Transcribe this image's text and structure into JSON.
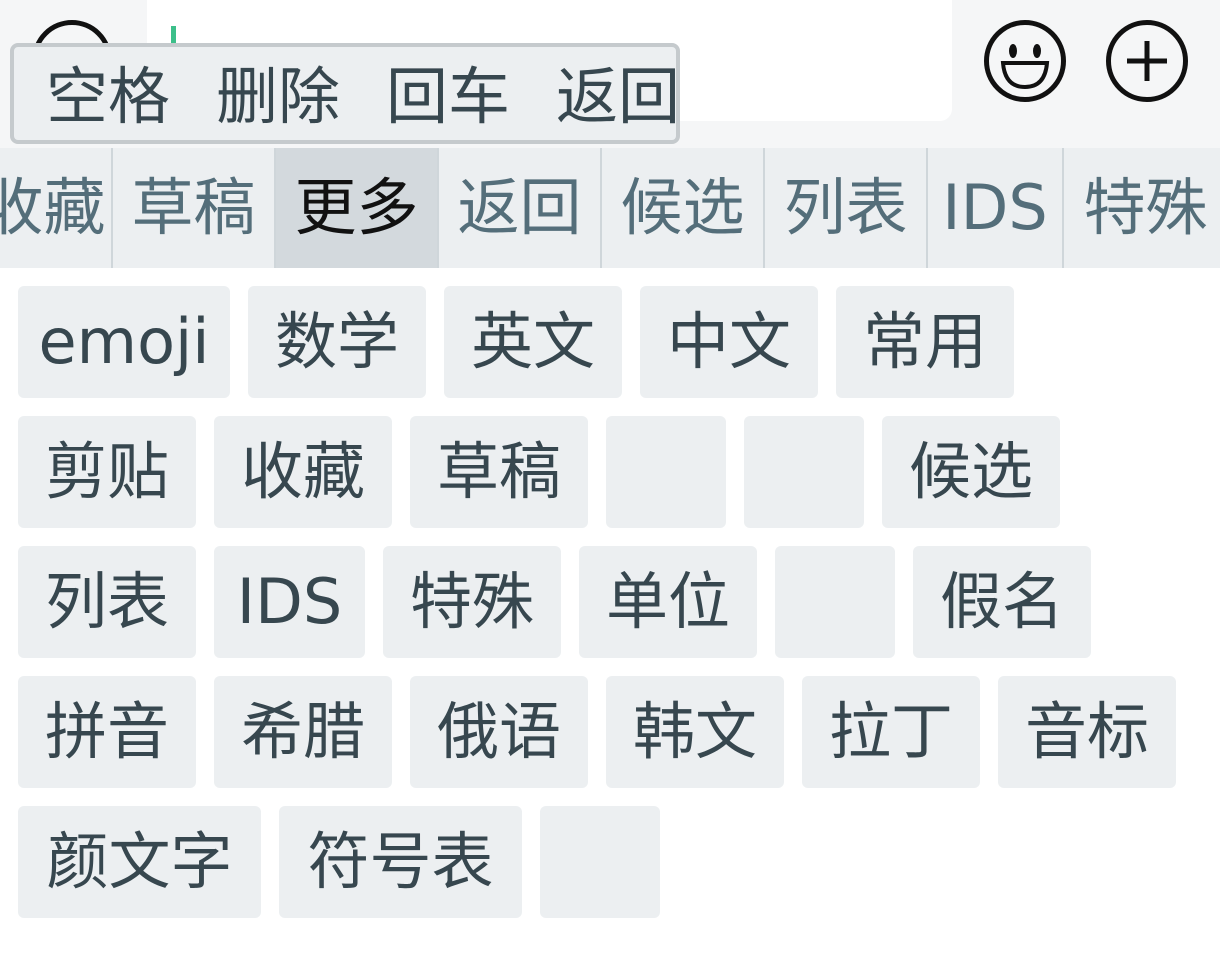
{
  "input": {
    "value": ""
  },
  "quick_popup": {
    "items": [
      "空格",
      "删除",
      "回车",
      "返回"
    ]
  },
  "icons": {
    "voice": "microphone-icon",
    "emoji": "smiley-face-icon",
    "add": "plus-circle-icon"
  },
  "tabs": [
    {
      "label": "收藏",
      "active": false
    },
    {
      "label": "草稿",
      "active": false
    },
    {
      "label": "更多",
      "active": true
    },
    {
      "label": "返回",
      "active": false
    },
    {
      "label": "候选",
      "active": false
    },
    {
      "label": "列表",
      "active": false
    },
    {
      "label": "IDS",
      "active": false
    },
    {
      "label": "特殊",
      "active": false
    }
  ],
  "grid": {
    "rows": [
      [
        "emoji",
        "数学",
        "英文",
        "中文",
        "常用"
      ],
      [
        "剪贴",
        "收藏",
        "草稿",
        "",
        "",
        "候选"
      ],
      [
        "列表",
        "IDS",
        "特殊",
        "单位",
        "",
        "假名"
      ],
      [
        "拼音",
        "希腊",
        "俄语",
        "韩文",
        "拉丁",
        "音标"
      ],
      [
        "颜文字",
        "符号表",
        ""
      ]
    ]
  },
  "colors": {
    "key_bg": "#eceff1",
    "active_tab_bg": "#d3d9dd",
    "caret": "#3cbf8a",
    "text": "#37474f"
  }
}
